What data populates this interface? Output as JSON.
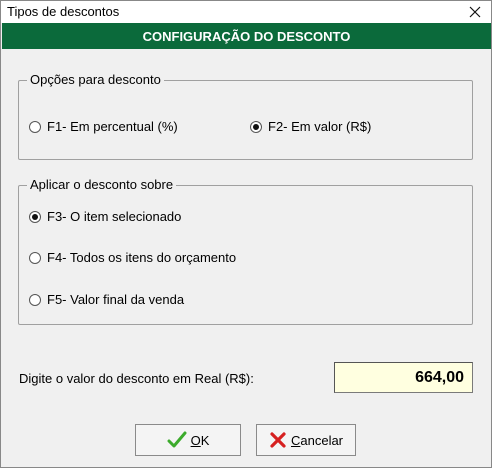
{
  "window": {
    "title": "Tipos de descontos",
    "header": "CONFIGURAÇÃO DO DESCONTO"
  },
  "options_group": {
    "legend": "Opções para desconto",
    "items": [
      {
        "label": "F1- Em percentual (%)",
        "selected": false
      },
      {
        "label": "F2- Em valor (R$)",
        "selected": true
      }
    ]
  },
  "apply_group": {
    "legend": "Aplicar o desconto sobre",
    "items": [
      {
        "label": "F3- O item selecionado",
        "selected": true
      },
      {
        "label": "F4- Todos os itens do orçamento",
        "selected": false
      },
      {
        "label": "F5- Valor final da venda",
        "selected": false
      }
    ]
  },
  "discount": {
    "label": "Digite o valor do desconto em Real (R$):",
    "value": "664,00"
  },
  "buttons": {
    "ok_first": "O",
    "ok_rest": "K",
    "cancel_first": "C",
    "cancel_rest": "ancelar"
  },
  "colors": {
    "header_bg": "#0b6a3b",
    "input_bg": "#ffffe0",
    "ok_icon": "#3cab2c",
    "cancel_icon": "#d62020"
  },
  "icons": {
    "close": "close-icon",
    "ok": "checkmark-icon",
    "cancel": "cross-icon"
  }
}
